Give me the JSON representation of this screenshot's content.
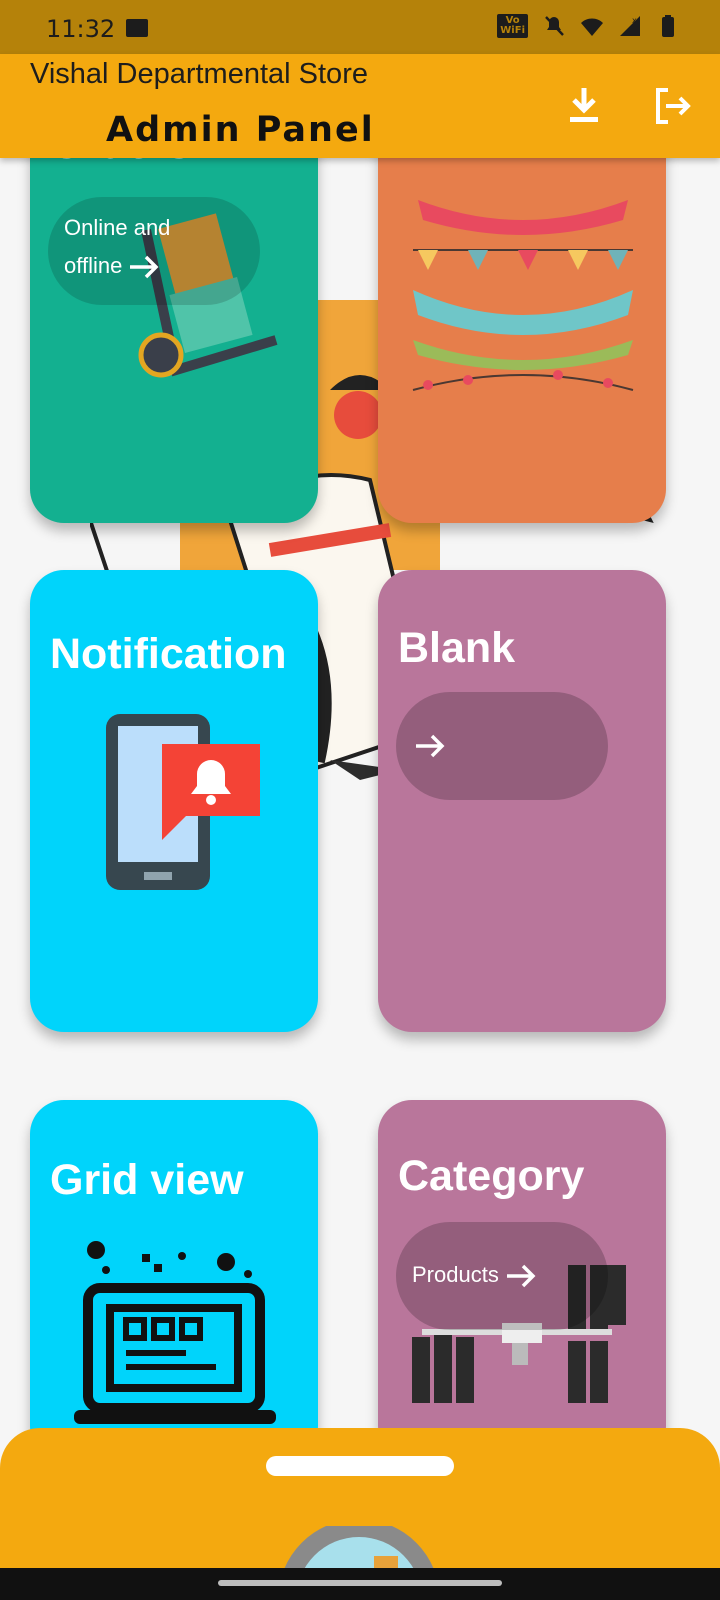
{
  "status": {
    "time": "11:32",
    "vowifi_top": "Vo",
    "vowifi_bottom": "WiFi"
  },
  "header": {
    "store_name": "Vishal Departmental Store",
    "panel_title": "Admin Panel"
  },
  "cards": {
    "orders": {
      "title": "Orders",
      "pill_line1": "Online and",
      "pill_line2": "offline"
    },
    "festive": {},
    "notification": {
      "title": "Notification"
    },
    "blank": {
      "title": "Blank"
    },
    "grid_view": {
      "title": "Grid view"
    },
    "category": {
      "title": "Category",
      "pill_label": "Products"
    }
  },
  "colors": {
    "appbar": "#f4a90f",
    "teal": "#13b090",
    "orange": "#e67e4b",
    "cyan": "#00d4fb",
    "mauve": "#b9769b",
    "pill_dark": "rgba(0,0,0,0.2)"
  }
}
